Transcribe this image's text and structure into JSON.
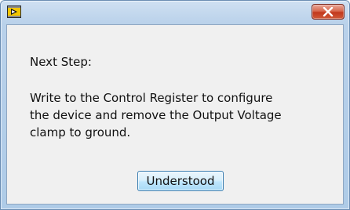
{
  "window": {
    "app_icon": "labview-run-arrow-icon",
    "close_icon": "close-x-icon"
  },
  "dialog": {
    "heading": "Next Step:",
    "message_lines": [
      "Write to the Control Register to configure",
      "the device and remove the Output Voltage",
      "clamp to ground."
    ],
    "button_label": "Understood"
  },
  "colors": {
    "frame": "#b9d1ea",
    "client_bg": "#f0f0f0",
    "close_red": "#c2381c",
    "button_border": "#3c7fb1",
    "icon_yellow": "#f2c500"
  }
}
